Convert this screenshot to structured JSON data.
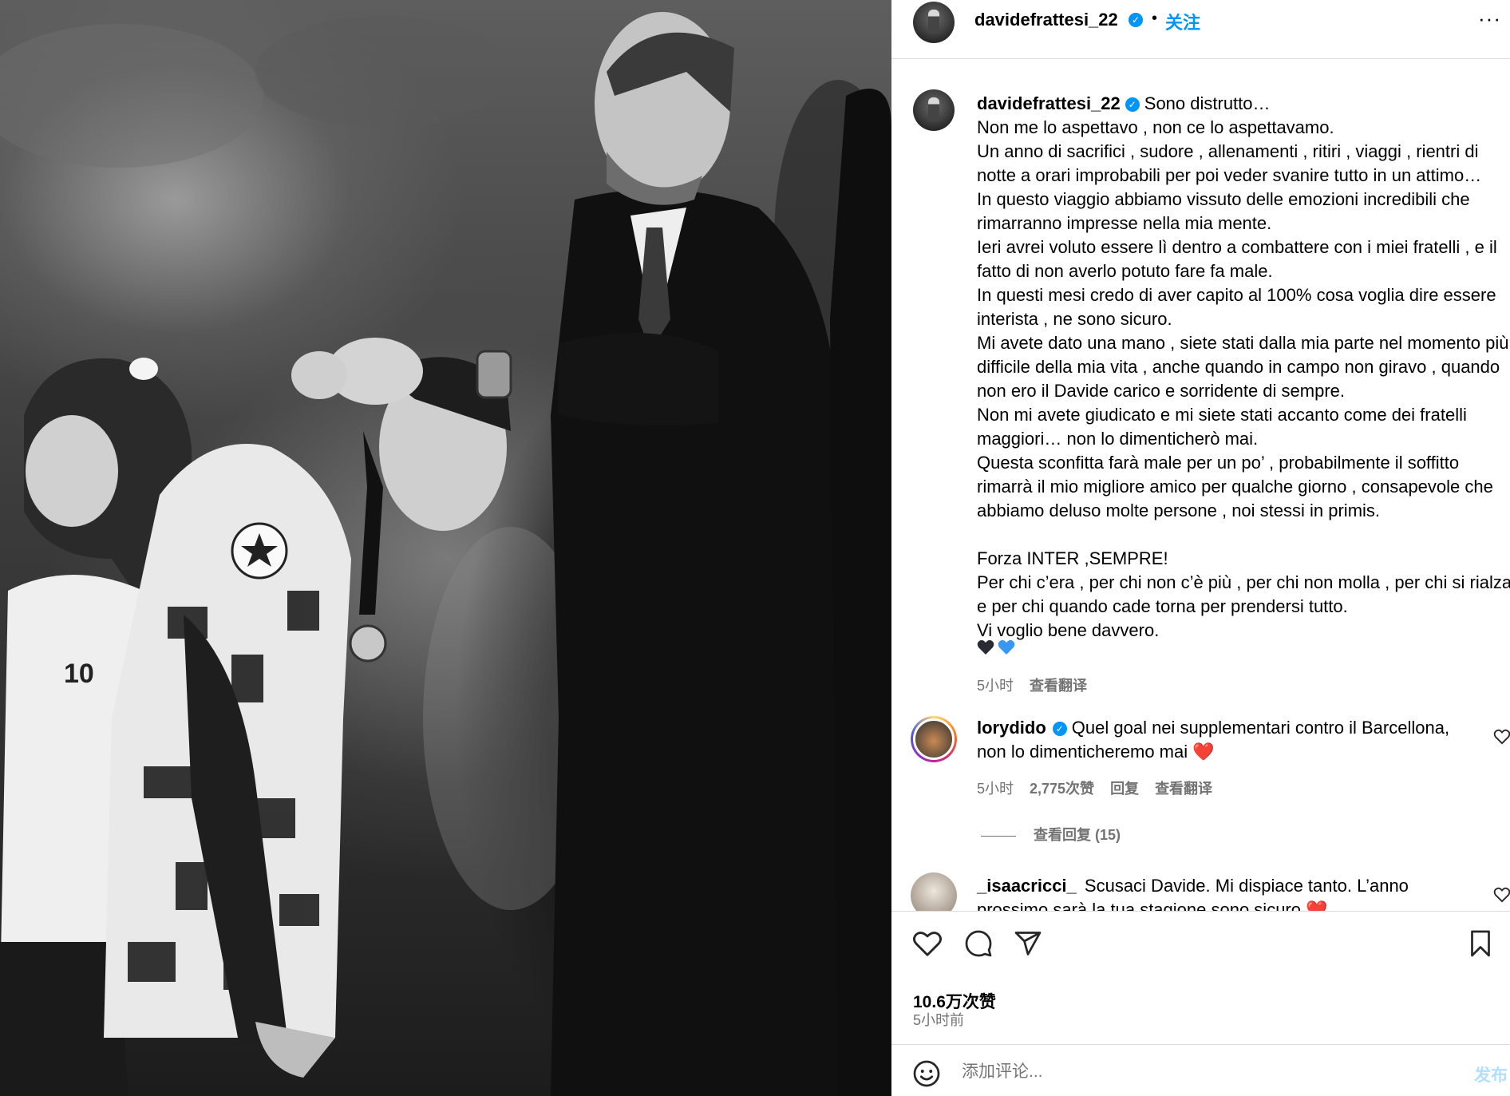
{
  "post": {
    "username": "davidefrattesi_22",
    "verified_mark": "✓",
    "separator": "•",
    "follow_label": "关注",
    "more_label": "···"
  },
  "caption": {
    "username": "davidefrattesi_22",
    "text": "Sono distrutto…\nNon me lo aspettavo , non ce lo aspettavamo.\nUn anno di sacrifici , sudore , allenamenti , ritiri , viaggi , rientri di notte a orari improbabili per poi veder svanire tutto in un attimo…\nIn questo viaggio abbiamo vissuto delle emozioni incredibili che rimarranno impresse nella mia mente.\nIeri avrei voluto essere lì dentro a combattere con i miei fratelli , e il fatto di non averlo potuto fare fa male.\nIn questi mesi credo di aver capito al 100% cosa voglia dire essere interista , ne sono sicuro.\nMi avete dato una mano , siete stati dalla mia parte nel momento più difficile della mia vita , anche quando in campo non giravo , quando non ero il Davide carico e sorridente di sempre.\nNon mi avete giudicato e mi siete stati accanto come dei fratelli maggiori… non lo dimenticherò mai.\nQuesta sconfitta farà male per un po’ , probabilmente il soffitto rimarrà il mio migliore amico per qualche giorno , consapevole che abbiamo deluso molte persone , noi stessi in primis.\n\nForza INTER ,SEMPRE!\nPer chi c’era , per chi non c’è più , per chi non molla , per chi si rialza e per chi quando cade torna per prendersi tutto.\nVi voglio bene davvero.",
    "time": "5小时",
    "translate": "查看翻译"
  },
  "comments": [
    {
      "username": "lorydido",
      "verified": true,
      "text": "Quel goal nei supplementari contro il Barcellona, non lo dimenticheremo mai ",
      "emoji": "❤️",
      "time": "5小时",
      "likes": "2,775次赞",
      "reply": "回复",
      "translate": "查看翻译",
      "view_replies": "查看回复 (15)"
    },
    {
      "username": "_isaacricci_",
      "verified": false,
      "text": "Scusaci Davide. Mi dispiace tanto. L’anno prossimo sarà la tua stagione sono sicuro ",
      "emoji": "❤️"
    }
  ],
  "stats": {
    "likes": "10.6万次赞",
    "time_ago": "5小时前"
  },
  "comment_box": {
    "placeholder": "添加评论...",
    "post_label": "发布"
  },
  "colors": {
    "accent": "#0095f6",
    "muted": "#737373",
    "border": "#dbdbdb",
    "heart_red": "#ff3040",
    "heart_blue": "#3897f0"
  },
  "icons": {
    "like": "heart-outline-icon",
    "comment": "speech-bubble-icon",
    "share": "paper-plane-icon",
    "save": "bookmark-icon",
    "emoji": "smiley-icon",
    "more": "ellipsis-icon"
  }
}
